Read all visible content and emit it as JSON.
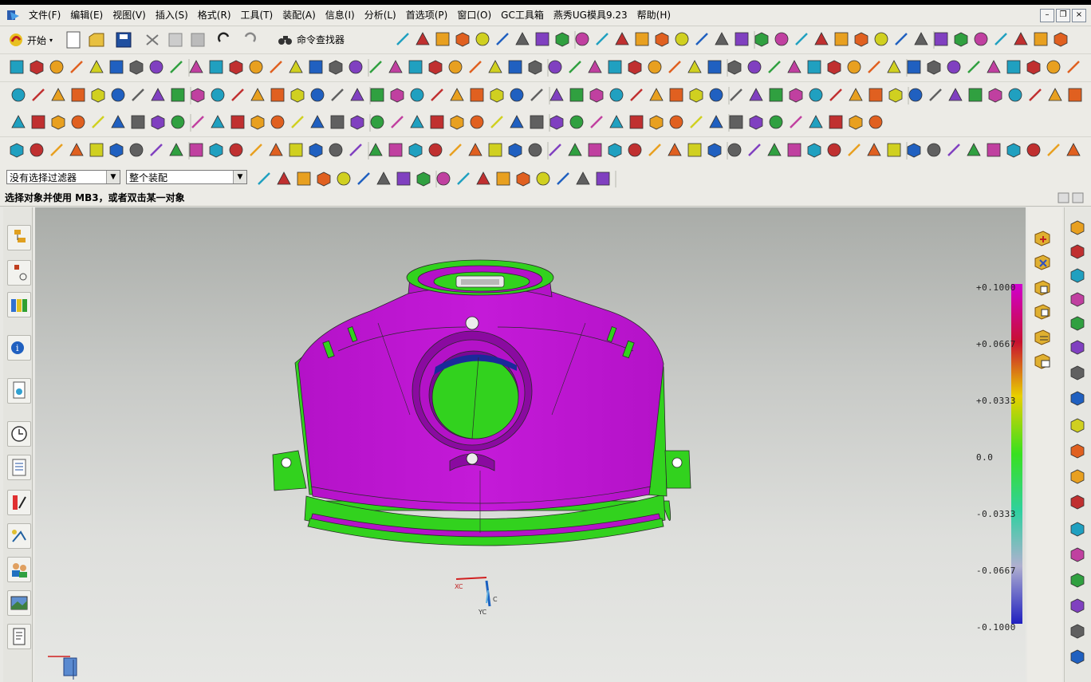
{
  "menu": {
    "items": [
      "文件(F)",
      "编辑(E)",
      "视图(V)",
      "插入(S)",
      "格式(R)",
      "工具(T)",
      "装配(A)",
      "信息(I)",
      "分析(L)",
      "首选项(P)",
      "窗口(O)",
      "GC工具箱",
      "燕秀UG模具9.23",
      "帮助(H)"
    ]
  },
  "window_controls": {
    "minimize": "–",
    "restore": "❐",
    "close": "×"
  },
  "toolbar": {
    "start_label": "开始",
    "command_finder_label": "命令查找器"
  },
  "filter": {
    "selection_filter": "没有选择过滤器",
    "assembly_scope": "整个装配"
  },
  "status": {
    "prompt": "选择对象并使用 MB3，或者双击某一对象"
  },
  "color_scale": {
    "labels": [
      "+0.1000",
      "+0.0667",
      "+0.0333",
      "0.0",
      "-0.0333",
      "-0.0667",
      "-0.1000"
    ],
    "colors": [
      "#d000d0",
      "#c81030",
      "#e8d000",
      "#38e020",
      "#30d0a0",
      "#b0b0d0",
      "#2020c0"
    ]
  },
  "triad": {
    "x_label": "XC",
    "y_label": "YC",
    "z_label": "C"
  },
  "model_colors": {
    "face": "#b412c8",
    "face_dark": "#8a0aa0",
    "deviation": "#32d21e",
    "edge": "#2a2a2a"
  }
}
